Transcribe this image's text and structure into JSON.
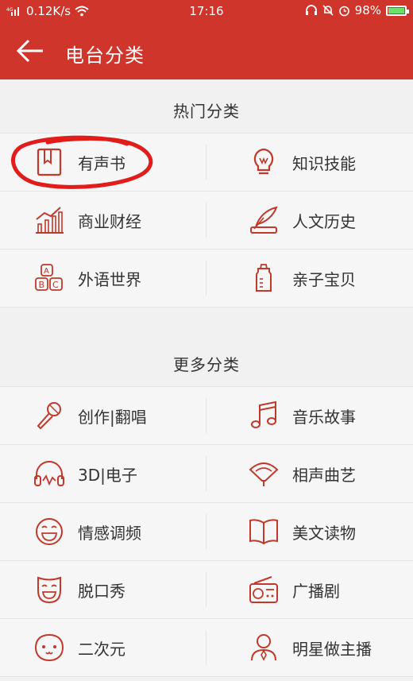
{
  "status_bar": {
    "network": "0.12K/s",
    "time": "17:16",
    "battery": "98%"
  },
  "header": {
    "title": "电台分类"
  },
  "hot": {
    "title": "热门分类",
    "items": [
      {
        "label": "有声书",
        "icon": "book-icon"
      },
      {
        "label": "知识技能",
        "icon": "lightbulb-icon"
      },
      {
        "label": "商业财经",
        "icon": "chart-icon"
      },
      {
        "label": "人文历史",
        "icon": "quill-books-icon"
      },
      {
        "label": "外语世界",
        "icon": "abc-blocks-icon"
      },
      {
        "label": "亲子宝贝",
        "icon": "baby-bottle-icon"
      }
    ]
  },
  "more": {
    "title": "更多分类",
    "items": [
      {
        "label": "创作|翻唱",
        "icon": "microphone-icon"
      },
      {
        "label": "音乐故事",
        "icon": "music-note-icon"
      },
      {
        "label": "3D|电子",
        "icon": "headphones-icon"
      },
      {
        "label": "相声曲艺",
        "icon": "fan-icon"
      },
      {
        "label": "情感调频",
        "icon": "smiley-icon"
      },
      {
        "label": "美文读物",
        "icon": "open-book-icon"
      },
      {
        "label": "脱口秀",
        "icon": "mask-icon"
      },
      {
        "label": "广播剧",
        "icon": "radio-icon"
      },
      {
        "label": "二次元",
        "icon": "cute-face-icon"
      },
      {
        "label": "明星做主播",
        "icon": "star-person-icon"
      }
    ]
  },
  "colors": {
    "accent": "#d0352b",
    "icon": "#c0392b",
    "annotation": "#e21b1b"
  }
}
